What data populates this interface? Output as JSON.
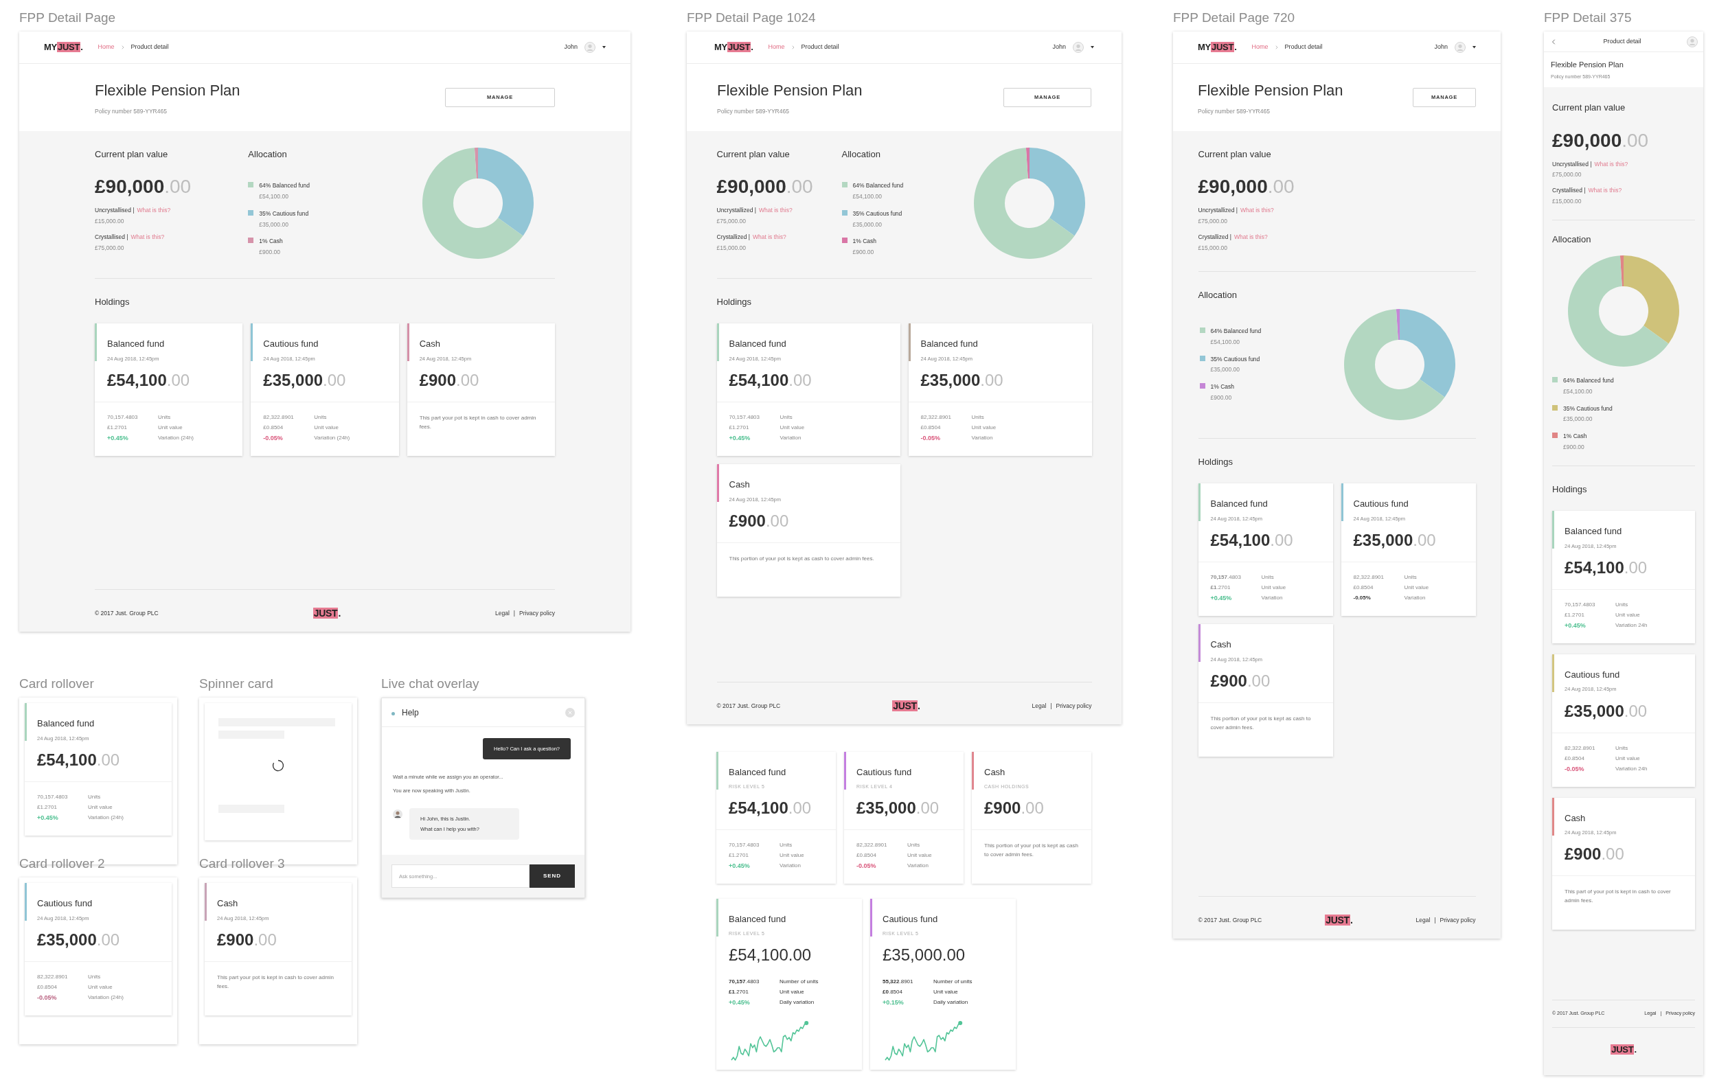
{
  "boards": [
    {
      "kind": "wide_page",
      "title": "FPP Detail Page",
      "nav": {
        "kind": "full",
        "logo": {
          "plain": "MY",
          "marked": "JUST",
          "tail": "."
        },
        "crumbs": [
          {
            "label": "Home",
            "selected": false
          },
          {
            "label": "Product detail",
            "selected": true
          }
        ],
        "user": "John"
      },
      "heading": {
        "title": "Flexible Pension Plan",
        "policy": "Policy number 589-YYR465",
        "manage": "MANAGE"
      },
      "plan": {
        "heading": "Current plan value",
        "value": {
          "whole": "£90,000",
          "decimal": ".00"
        },
        "lines": [
          {
            "label": "Uncrystallised |",
            "link": "What is this?",
            "amount": "£15,000.00"
          },
          {
            "label": "Crystallised |",
            "link": "What is this?",
            "amount": "£75,000.00"
          }
        ]
      },
      "allocation": {
        "heading": "Allocation",
        "items": [
          {
            "label": "64% Balanced fund",
            "amount": "£54,100.00",
            "color": "#b3d7c1"
          },
          {
            "label": "35% Cautious fund",
            "amount": "£35,000.00",
            "color": "#93c6d6"
          },
          {
            "label": "1% Cash",
            "amount": "£900.00",
            "color": "#d693aa"
          }
        ],
        "chart_data": {
          "type": "donut",
          "values": [
            64,
            35,
            1
          ]
        }
      },
      "holdings": {
        "heading": "Holdings",
        "cards": [
          {
            "kind": "fund",
            "name": "Balanced fund",
            "date": "24 Aug 2018, 12:45pm",
            "color": "#a9d5bd",
            "value": {
              "whole": "£54,100",
              "decimal": ".00"
            },
            "stats": [
              {
                "figure": "70,157.4803",
                "label": "Units"
              },
              {
                "figure": "£1.2701",
                "label": "Unit value"
              },
              {
                "figure": "+0.45%",
                "label": "Variation (24h)",
                "color": "#4cbf8f"
              }
            ]
          },
          {
            "kind": "fund",
            "name": "Cautious fund",
            "date": "24 Aug 2018, 12:45pm",
            "color": "#8fc5d5",
            "value": {
              "whole": "£35,000",
              "decimal": ".00"
            },
            "stats": [
              {
                "figure": "82,322.8901",
                "label": "Units"
              },
              {
                "figure": "£0.8504",
                "label": "Unit value"
              },
              {
                "figure": "-0.05%",
                "label": "Variation (24h)",
                "color": "#d9557a"
              }
            ]
          },
          {
            "kind": "cash",
            "name": "Cash",
            "date": "24 Aug 2018, 12:45pm",
            "color": "#d590a8",
            "value": {
              "whole": "£900",
              "decimal": ".00"
            },
            "note": "This part your pot is kept in cash to cover admin fees."
          }
        ]
      },
      "footer": {
        "copyright": "© 2017 Just. Group PLC",
        "logo": {
          "marked": "JUST",
          "tail": "."
        },
        "links": [
          "Legal",
          "Privacy policy"
        ],
        "separator": "|"
      }
    },
    {
      "kind": "medium_page",
      "title": "FPP Detail Page 1024",
      "nav": {
        "kind": "full",
        "logo": {
          "plain": "MY",
          "marked": "JUST",
          "tail": "."
        },
        "crumbs": [
          {
            "label": "Home",
            "selected": false
          },
          {
            "label": "Product detail",
            "selected": true
          }
        ],
        "user": "John"
      },
      "heading": {
        "title": "Flexible Pension Plan",
        "policy": "Policy number 589-YYR465",
        "manage": "MANAGE"
      },
      "plan": {
        "heading": "Current plan value",
        "value": {
          "whole": "£90,000",
          "decimal": ".00"
        },
        "lines": [
          {
            "label": "Uncrystallized |",
            "link": "What is this?",
            "amount": "£75,000.00"
          },
          {
            "label": "Crystallized |",
            "link": "What is this?",
            "amount": "£15,000.00"
          }
        ]
      },
      "allocation": {
        "heading": "Allocation",
        "items": [
          {
            "label": "64% Balanced fund",
            "amount": "£54,100.00",
            "color": "#b3d7c1"
          },
          {
            "label": "35% Cautious fund",
            "amount": "£35,000.00",
            "color": "#93c6d6"
          },
          {
            "label": "1% Cash",
            "amount": "£900.00",
            "color": "#d976a6"
          }
        ],
        "chart_data": {
          "type": "donut",
          "values": [
            64,
            35,
            1
          ]
        }
      },
      "holdings": {
        "heading": "Holdings",
        "cards": [
          {
            "kind": "fund",
            "name": "Balanced fund",
            "date": "24 Aug 2018, 12:45pm",
            "color": "#a9d5bd",
            "value": {
              "whole": "£54,100",
              "decimal": ".00"
            },
            "stats": [
              {
                "figure": "70,157.4803",
                "label": "Units"
              },
              {
                "figure": "£1.2701",
                "label": "Unit value"
              },
              {
                "figure": "+0.45%",
                "label": "Variation",
                "color": "#4cbf8f"
              }
            ]
          },
          {
            "kind": "fund",
            "name": "Balanced fund",
            "date": "24 Aug 2018, 12:45pm",
            "color": "#b9a99b",
            "value": {
              "whole": "£35,000",
              "decimal": ".00"
            },
            "stats": [
              {
                "figure": "82,322.8901",
                "label": "Units"
              },
              {
                "figure": "£0.8504",
                "label": "Unit value"
              },
              {
                "figure": "-0.05%",
                "label": "Variation",
                "color": "#d9557a"
              }
            ]
          },
          {
            "kind": "cash",
            "name": "Cash",
            "date": "24 Aug 2018, 12:45pm",
            "color": "#e07aa8",
            "value": {
              "whole": "£900",
              "decimal": ".00"
            },
            "note": "This portion of your pot is kept as cash to cover admin fees."
          }
        ]
      },
      "footer": {
        "copyright": "© 2017 Just. Group PLC",
        "logo": {
          "marked": "JUST",
          "tail": "."
        },
        "links": [
          "Legal",
          "Privacy policy"
        ],
        "separator": "|"
      }
    },
    {
      "kind": "narrow_page",
      "title": "FPP Detail Page 720",
      "nav": {
        "kind": "full",
        "logo": {
          "plain": "MY",
          "marked": "JUST",
          "tail": "."
        },
        "crumbs": [
          {
            "label": "Home",
            "selected": false
          },
          {
            "label": "Product detail",
            "selected": true
          }
        ],
        "user": "John"
      },
      "heading": {
        "title": "Flexible Pension Plan",
        "policy": "Policy number 589-YYR465",
        "manage": "MANAGE"
      },
      "plan": {
        "heading": "Current plan value",
        "value": {
          "whole": "£90,000",
          "decimal": ".00"
        },
        "lines": [
          {
            "label": "Uncrystallized |",
            "link": "What is this?",
            "amount": "£75,000.00"
          },
          {
            "label": "Crystallized |",
            "link": "What is this?",
            "amount": "£15,000.00"
          }
        ]
      },
      "allocation": {
        "heading": "Allocation",
        "items": [
          {
            "label": "64% Balanced fund",
            "amount": "£54,100.00",
            "color": "#b3d7c1"
          },
          {
            "label": "35% Cautious fund",
            "amount": "£35,000.00",
            "color": "#93c6d6"
          },
          {
            "label": "1% Cash",
            "amount": "£900.00",
            "color": "#c586d6"
          }
        ],
        "chart_data": {
          "type": "donut",
          "values": [
            64,
            35,
            1
          ]
        }
      },
      "holdings": {
        "heading": "Holdings",
        "cards": [
          {
            "kind": "fund",
            "name": "Balanced fund",
            "date": "24 Aug 2018, 12:45pm",
            "color": "#a9d5bd",
            "value": {
              "whole": "£54,100",
              "decimal": ".00"
            },
            "stats": [
              {
                "figure": "**70,157**.4803",
                "label": "Units"
              },
              {
                "figure": "**£1**.2701",
                "label": "Unit value"
              },
              {
                "figure": "+0.45%",
                "label": "Variation",
                "color": "#4cbf8f"
              }
            ]
          },
          {
            "kind": "fund",
            "name": "Cautious fund",
            "date": "24 Aug 2018, 12:45pm",
            "color": "#8fc5d5",
            "value": {
              "whole": "£35,000",
              "decimal": ".00"
            },
            "stats": [
              {
                "figure": "82,322.8901",
                "label": "Units"
              },
              {
                "figure": "£0.8504",
                "label": "Unit value"
              },
              {
                "figure": "**-0.05%**",
                "label": "Variation"
              }
            ]
          },
          {
            "kind": "cash",
            "name": "Cash",
            "date": "24 Aug 2018, 12:45pm",
            "color": "#c48ad8",
            "value": {
              "whole": "£900",
              "decimal": ".00"
            },
            "note": "This portion of your pot is kept as cash to cover admin fees."
          }
        ]
      },
      "footer": {
        "copyright": "© 2017 Just. Group PLC",
        "logo": {
          "marked": "JUST",
          "tail": "."
        },
        "links": [
          "Legal",
          "Privacy policy"
        ],
        "separator": "|"
      }
    },
    {
      "kind": "mobile_page",
      "title": "FPP Detail 375",
      "nav": {
        "kind": "compact",
        "title": "Product detail"
      },
      "heading": {
        "title": "Flexible Pension Plan",
        "policy": "Policy number 589-YYR465"
      },
      "plan": {
        "heading": "Current plan value",
        "value": {
          "whole": "£90,000",
          "decimal": ".00"
        },
        "lines": [
          {
            "label": "Uncrystallised |",
            "link": "What is this?",
            "amount": "£75,000.00"
          },
          {
            "label": "Crystallised |",
            "link": "What is this?",
            "amount": "£15,000.00"
          }
        ]
      },
      "allocation": {
        "heading": "Allocation",
        "items": [
          {
            "label": "64% Balanced fund",
            "amount": "£54,100.00",
            "color": "#b3d7c1"
          },
          {
            "label": "35% Cautious fund",
            "amount": "£35,000.00",
            "color": "#cfc27a"
          },
          {
            "label": "1% Cash",
            "amount": "£900.00",
            "color": "#e08585"
          }
        ],
        "chart_data": {
          "type": "donut",
          "values": [
            64,
            35,
            1
          ]
        }
      },
      "holdings": {
        "heading": "Holdings",
        "cards": [
          {
            "kind": "fund",
            "name": "Balanced fund",
            "date": "24 Aug 2018, 12:45pm",
            "color": "#a9d5bd",
            "value": {
              "whole": "£54,100",
              "decimal": ".00"
            },
            "stats": [
              {
                "figure": "70,157.4803",
                "label": "Units"
              },
              {
                "figure": "£1.2701",
                "label": "Unit value"
              },
              {
                "figure": "+0.45%",
                "label": "Variation 24h",
                "color": "#4cbf8f"
              }
            ]
          },
          {
            "kind": "fund",
            "name": "Cautious fund",
            "date": "24 Aug 2018, 12:45pm",
            "color": "#d2c57f",
            "value": {
              "whole": "£35,000",
              "decimal": ".00"
            },
            "stats": [
              {
                "figure": "82,322.8901",
                "label": "Units"
              },
              {
                "figure": "£0.8504",
                "label": "Unit value"
              },
              {
                "figure": "-0.05%",
                "label": "Variation 24h",
                "color": "#d9557a"
              }
            ]
          },
          {
            "kind": "cash",
            "name": "Cash",
            "date": "24 Aug 2018, 12:45pm",
            "color": "#e08888",
            "value": {
              "whole": "£900",
              "decimal": ".00"
            },
            "note": "This part of your pot is kept in cash to cover admin fees."
          }
        ]
      },
      "footer": {
        "copyright": "© 2017 Just. Group PLC",
        "logo": {
          "marked": "JUST",
          "tail": "."
        },
        "links": [
          "Legal",
          "Privacy policy"
        ],
        "separator": "|"
      }
    },
    {
      "kind": "rollover",
      "title": "Card rollover",
      "card": {
        "kind": "fund",
        "name": "Balanced fund",
        "date": "24 Aug 2018, 12:45pm",
        "color": "#a9d5bd",
        "value": {
          "whole": "£54,100",
          "decimal": ".00"
        },
        "stats": [
          {
            "figure": "70,157.4803",
            "label": "Units"
          },
          {
            "figure": "£1.2701",
            "label": "Unit value"
          },
          {
            "figure": "+0.45%",
            "label": "Variation (24h)",
            "color": "#4cbf8f"
          }
        ]
      }
    },
    {
      "kind": "spinner",
      "title": "Spinner card"
    },
    {
      "kind": "chat",
      "title": "Live chat overlay",
      "chat_title": "Help",
      "online": true,
      "messages": [
        {
          "kind": "sent",
          "text": "Hello? Can I ask a question?"
        },
        {
          "kind": "notice",
          "text": "Wait a minute while we assign you an operator..."
        },
        {
          "kind": "notice",
          "text": "You are now speaking with Justin."
        },
        {
          "kind": "received",
          "lines": [
            "Hi John, this is Justin.",
            "What can I help you with?"
          ]
        }
      ],
      "input": {
        "placeholder": "Ask something..."
      },
      "send": "SEND"
    },
    {
      "kind": "rollover",
      "title": "Card rollover 2",
      "card": {
        "kind": "fund",
        "name": "Cautious fund",
        "date": "24 Aug 2018, 12:45pm",
        "color": "#8fc5d5",
        "value": {
          "whole": "£35,000",
          "decimal": ".00"
        },
        "stats": [
          {
            "figure": "82,322.8901",
            "label": "Units"
          },
          {
            "figure": "£0.8504",
            "label": "Unit value"
          },
          {
            "figure": "-0.05%",
            "label": "Variation (24h)",
            "color": "#b8607f"
          }
        ]
      }
    },
    {
      "kind": "rollover",
      "title": "Card rollover 3",
      "card": {
        "kind": "cash",
        "name": "Cash",
        "date": "24 Aug 2018, 12:45pm",
        "color": "#c8a3b6",
        "value": {
          "whole": "£900",
          "decimal": ".00"
        },
        "note": "This part your pot is kept in cash to cover admin fees."
      }
    },
    {
      "kind": "cards",
      "rows": [
        [
          {
            "kind": "fund",
            "name": "Balanced fund",
            "risk": "RISK LEVEL 5",
            "color": "#a9d5bd",
            "value": {
              "whole": "£54,100",
              "decimal": ".00"
            },
            "stats": [
              {
                "figure": "70,157.4803",
                "label": "Units"
              },
              {
                "figure": "£1.2701",
                "label": "Unit value"
              },
              {
                "figure": "+0.45%",
                "label": "Variation",
                "color": "#4cbf8f"
              }
            ]
          },
          {
            "kind": "fund",
            "name": "Cautious fund",
            "risk": "RISK LEVEL 4",
            "color": "#c47fe0",
            "value": {
              "whole": "£35,000",
              "decimal": ".00"
            },
            "stats": [
              {
                "figure": "82,322.8901",
                "label": "Units"
              },
              {
                "figure": "£0.8504",
                "label": "Unit value"
              },
              {
                "figure": "-0.05%",
                "label": "Variation",
                "color": "#d9557a"
              }
            ]
          },
          {
            "kind": "cash",
            "name": "Cash",
            "risk": "CASH HOLDINGS",
            "color": "#e0868f",
            "value": {
              "whole": "£900",
              "decimal": ".00"
            },
            "note": "This portion of your pot is kept as cash to cover admin fees."
          }
        ],
        [
          {
            "kind": "chart",
            "name": "Balanced fund",
            "risk": "RISK LEVEL 5",
            "color": "#a9d5bd",
            "value": {
              "whole": "£54,100",
              "decimal": ".00"
            },
            "stats": [
              {
                "figure": "**70,157**.4803",
                "label": "Number of units"
              },
              {
                "figure": "**£1**.2701",
                "label": "Unit value"
              },
              {
                "figure": "+0.45%",
                "label": "Daily variation",
                "color": "#4cbf8f"
              }
            ]
          },
          {
            "kind": "chart",
            "name": "Cautious fund",
            "risk": "RISK LEVEL 5",
            "color": "#c47fe0",
            "value": {
              "whole": "£35,000",
              "decimal": ".00"
            },
            "stats": [
              {
                "figure": "**55,322**.8901",
                "label": "Number of units"
              },
              {
                "figure": "**£0**.8504",
                "label": "Unit value"
              },
              {
                "figure": "+0.15%",
                "label": "Daily variation",
                "color": "#4cbf8f"
              }
            ]
          }
        ]
      ]
    }
  ]
}
